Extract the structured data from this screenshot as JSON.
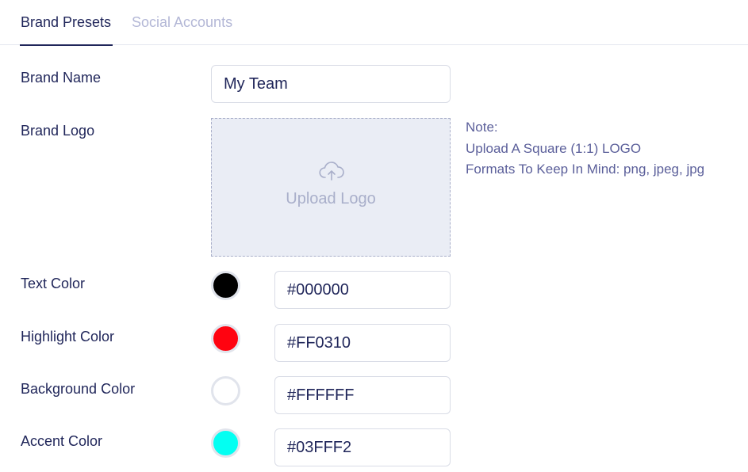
{
  "tabs": {
    "brand_presets": "Brand Presets",
    "social_accounts": "Social Accounts"
  },
  "brand_name": {
    "label": "Brand Name",
    "value": "My Team"
  },
  "brand_logo": {
    "label": "Brand Logo",
    "upload_label": "Upload Logo",
    "icon": "cloud-upload-icon"
  },
  "note": {
    "title": "Note:",
    "line1": "Upload A Square (1:1) LOGO",
    "line2": "Formats To Keep In Mind: png, jpeg, jpg"
  },
  "colors": {
    "text": {
      "label": "Text Color",
      "value": "#000000",
      "swatch": "#000000"
    },
    "highlight": {
      "label": "Highlight Color",
      "value": "#FF0310",
      "swatch": "#FF0310"
    },
    "background": {
      "label": "Background Color",
      "value": "#FFFFFF",
      "swatch": "#FFFFFF"
    },
    "accent": {
      "label": "Accent Color",
      "value": "#03FFF2",
      "swatch": "#03FFF2"
    }
  }
}
